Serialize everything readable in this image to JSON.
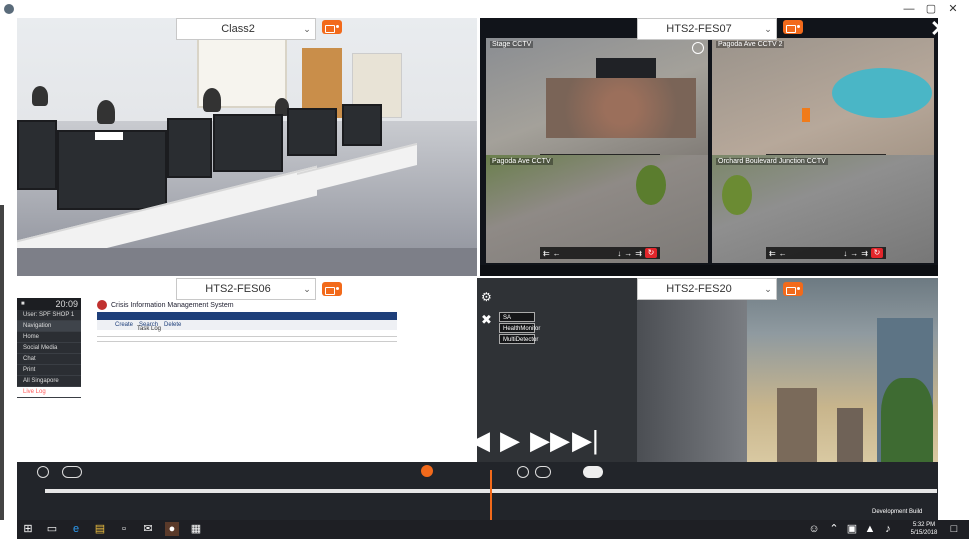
{
  "window": {
    "title": "   ",
    "controls": [
      "—",
      "▢",
      "✕"
    ]
  },
  "quadrants": {
    "top_left": {
      "selector_label": "Class2"
    },
    "top_right": {
      "selector_label": "HTS2-FES07",
      "cameras": [
        {
          "label": "Stage CCTV"
        },
        {
          "label": "Pagoda Ave CCTV 2"
        },
        {
          "label": "Pagoda Ave CCTV"
        },
        {
          "label": "Orchard Boulevard Junction CCTV"
        }
      ]
    },
    "bottom_left": {
      "selector_label": "HTS2-FES06",
      "clock": "20:09",
      "user": "User: SPF SHOP 1",
      "nav_title": "Navigation",
      "nav_items": [
        "Home",
        "Social Media",
        "Chat",
        "Print",
        "All Singapore",
        "Live Log"
      ],
      "app_title": "Crisis Information Management System",
      "tabs": [
        "Create",
        "Search",
        "Delete"
      ],
      "table_title": "Task Log"
    },
    "bottom_right": {
      "selector_label": "HTS2-FES20",
      "menu_items": [
        "SA",
        "HealthMonitor",
        "MultiDetector"
      ]
    }
  },
  "controls": {
    "watermark": "Development Build",
    "progress": 0.5
  },
  "taskbar": {
    "time": "5:32 PM",
    "date": "5/15/2018"
  },
  "colors": {
    "accent": "#f26a1b",
    "dark": "#22252a"
  }
}
